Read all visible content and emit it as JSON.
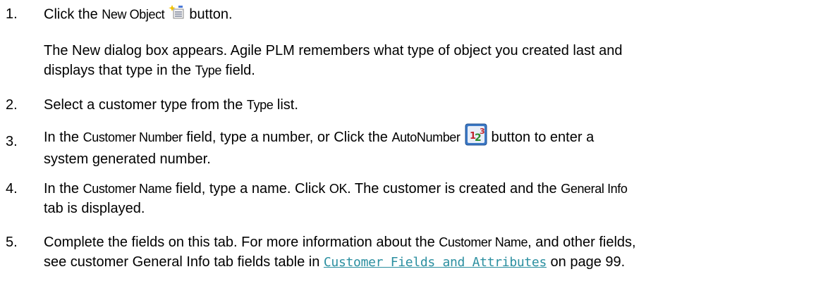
{
  "steps": [
    {
      "num": "1.",
      "pre": "Click the ",
      "ui": "New Object",
      "post": " button.",
      "icon": "new-object-icon"
    },
    {
      "para_line1": "The New dialog box appears. Agile PLM remembers what type of object you created last and",
      "para_line2_pre": "displays that type in the ",
      "para_line2_ui": "Type",
      "para_line2_post": " field."
    },
    {
      "num": "2.",
      "pre": "Select a customer type from the ",
      "ui": "Type",
      "post": " list."
    },
    {
      "num": "3.",
      "pre": "In the ",
      "ui1": "Customer Number",
      "mid": " field, type a number, or Click the ",
      "ui2": "AutoNumber",
      "post": " button to enter a",
      "line2": "system generated number.",
      "icon": "autonumber-icon"
    },
    {
      "num": "4.",
      "pre": "In the ",
      "ui1": "Customer Name",
      "mid": " field, type a name. Click ",
      "ui2": "OK",
      "mid2": ". The customer is created and the ",
      "ui3": "General Info",
      "line2": "tab is displayed."
    },
    {
      "num": "5.",
      "pre": "Complete the fields on this tab. For more information about the ",
      "ui1": "Customer Name",
      "post": ", and other fields,",
      "line2_pre": "see customer General Info tab fields table in ",
      "link": "Customer Fields and Attributes",
      "line2_post": " on page 99."
    }
  ]
}
